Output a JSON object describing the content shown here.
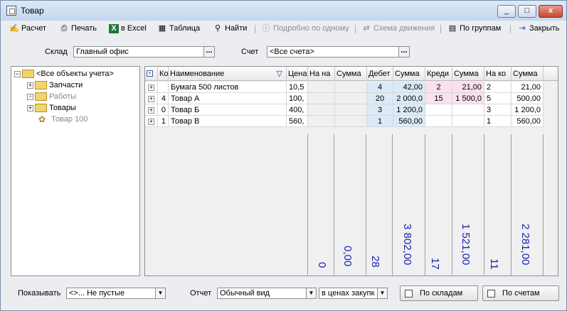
{
  "window": {
    "title": "Товар",
    "minimize": "_",
    "maximize": "□",
    "close": "x"
  },
  "toolbar": {
    "calc": "Расчет",
    "print": "Печать",
    "excel": "в Excel",
    "table": "Таблица",
    "find": "Найти",
    "detail": "Подробно по одному",
    "scheme": "Схема движения",
    "groups": "По группам",
    "close": "Закрыть"
  },
  "filters": {
    "warehouse_label": "Склад",
    "warehouse_value": "Главный офис",
    "account_label": "Счет",
    "account_value": "<Все счета>",
    "ellipsis": "..."
  },
  "tree": {
    "root": "<Все объекты учета>",
    "items": [
      "Запчасти",
      "Работы",
      "Товары"
    ],
    "leaf": "Товар 100"
  },
  "grid": {
    "columns": [
      "Ко",
      "Наименование",
      "Цена",
      "На на",
      "Сумма",
      "Дебет",
      "Сумма",
      "Креди",
      "Сумма",
      "На ко",
      "Сумма"
    ],
    "rows": [
      {
        "code": "",
        "name": "Бумага 500 листов",
        "price": "10,5",
        "debit": "4",
        "debit_sum": "42,00",
        "credit": "2",
        "credit_sum": "21,00",
        "end": "2",
        "end_sum": "21,00"
      },
      {
        "code": "4",
        "name": "Товар А",
        "price": "100,",
        "debit": "20",
        "debit_sum": "2 000,0",
        "credit": "15",
        "credit_sum": "1 500,0",
        "end": "5",
        "end_sum": "500,00"
      },
      {
        "code": "0",
        "name": "Товар Б",
        "price": "400,",
        "debit": "3",
        "debit_sum": "1 200,0",
        "credit": "",
        "credit_sum": "",
        "end": "3",
        "end_sum": "1 200,0"
      },
      {
        "code": "1",
        "name": "Товар В",
        "price": "560,",
        "debit": "1",
        "debit_sum": "560,00",
        "credit": "",
        "credit_sum": "",
        "end": "1",
        "end_sum": "560,00"
      }
    ],
    "totals": {
      "start_qty": "0",
      "start_sum": "0,00",
      "debit_qty": "28",
      "debit_sum": "3 802,00",
      "credit_qty": "17",
      "credit_sum": "1 521,00",
      "end_qty": "11",
      "end_sum": "2 281,00"
    }
  },
  "bottom": {
    "show_label": "Показывать",
    "show_value": "<>...   Не пустые",
    "report_label": "Отчет",
    "report_value": "Обычный вид",
    "price_value": "в ценах закупк",
    "by_warehouses": "По складам",
    "by_accounts": "По счетам"
  },
  "colors": {
    "debit_bg": "#dceaf7",
    "credit_bg": "#fbe0ef",
    "totals": "#1a20b0"
  }
}
